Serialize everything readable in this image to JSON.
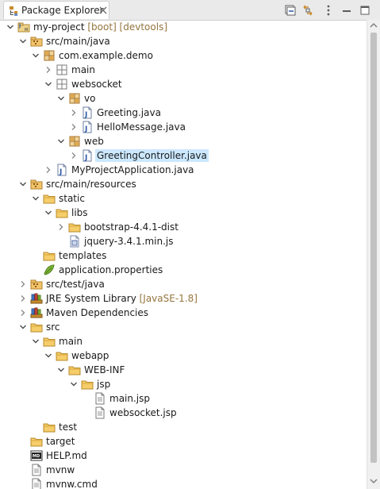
{
  "view": {
    "tab_title": "Package Explorer",
    "tab_icon": "package-explorer-icon",
    "toolbar": [
      {
        "name": "collapse-all-button",
        "icon": "collapse-all-icon"
      },
      {
        "name": "link-with-editor-button",
        "icon": "link-with-editor-icon"
      },
      {
        "name": "view-menu-button",
        "icon": "view-menu-icon"
      },
      {
        "name": "minimize-button",
        "icon": "minimize-icon"
      },
      {
        "name": "maximize-button",
        "icon": "maximize-icon"
      }
    ]
  },
  "tree": [
    {
      "depth": 0,
      "expand": "open",
      "icon": "project",
      "label": "my-project",
      "decor": "[boot] [devtools]"
    },
    {
      "depth": 1,
      "expand": "open",
      "icon": "source-folder",
      "label": "src/main/java"
    },
    {
      "depth": 2,
      "expand": "open",
      "icon": "package",
      "label": "com.example.demo"
    },
    {
      "depth": 3,
      "expand": "closed",
      "icon": "package-empty",
      "label": "main"
    },
    {
      "depth": 3,
      "expand": "open",
      "icon": "package-empty",
      "label": "websocket"
    },
    {
      "depth": 4,
      "expand": "open",
      "icon": "package",
      "label": "vo"
    },
    {
      "depth": 5,
      "expand": "closed",
      "icon": "java-file",
      "label": "Greeting.java"
    },
    {
      "depth": 5,
      "expand": "closed",
      "icon": "java-file",
      "label": "HelloMessage.java"
    },
    {
      "depth": 4,
      "expand": "open",
      "icon": "package",
      "label": "web"
    },
    {
      "depth": 5,
      "expand": "closed",
      "icon": "java-file",
      "label": "GreetingController.java",
      "selected": true
    },
    {
      "depth": 3,
      "expand": "closed",
      "icon": "java-file",
      "label": "MyProjectApplication.java"
    },
    {
      "depth": 1,
      "expand": "open",
      "icon": "source-folder",
      "label": "src/main/resources"
    },
    {
      "depth": 2,
      "expand": "open",
      "icon": "folder",
      "label": "static"
    },
    {
      "depth": 3,
      "expand": "open",
      "icon": "folder",
      "label": "libs"
    },
    {
      "depth": 4,
      "expand": "closed",
      "icon": "folder",
      "label": "bootstrap-4.4.1-dist"
    },
    {
      "depth": 4,
      "expand": "none",
      "icon": "js-file",
      "label": "jquery-3.4.1.min.js"
    },
    {
      "depth": 2,
      "expand": "none",
      "icon": "folder",
      "label": "templates"
    },
    {
      "depth": 2,
      "expand": "none",
      "icon": "properties-file",
      "label": "application.properties"
    },
    {
      "depth": 1,
      "expand": "closed",
      "icon": "source-folder",
      "label": "src/test/java"
    },
    {
      "depth": 1,
      "expand": "closed",
      "icon": "library",
      "label": "JRE System Library",
      "decor": "[JavaSE-1.8]"
    },
    {
      "depth": 1,
      "expand": "closed",
      "icon": "library",
      "label": "Maven Dependencies"
    },
    {
      "depth": 1,
      "expand": "open",
      "icon": "folder",
      "label": "src"
    },
    {
      "depth": 2,
      "expand": "open",
      "icon": "folder",
      "label": "main"
    },
    {
      "depth": 3,
      "expand": "open",
      "icon": "folder",
      "label": "webapp"
    },
    {
      "depth": 4,
      "expand": "open",
      "icon": "folder",
      "label": "WEB-INF"
    },
    {
      "depth": 5,
      "expand": "open",
      "icon": "folder",
      "label": "jsp"
    },
    {
      "depth": 6,
      "expand": "none",
      "icon": "text-file",
      "label": "main.jsp"
    },
    {
      "depth": 6,
      "expand": "none",
      "icon": "text-file",
      "label": "websocket.jsp"
    },
    {
      "depth": 2,
      "expand": "none",
      "icon": "folder",
      "label": "test"
    },
    {
      "depth": 1,
      "expand": "none",
      "icon": "folder",
      "label": "target"
    },
    {
      "depth": 1,
      "expand": "none",
      "icon": "md-file",
      "label": "HELP.md"
    },
    {
      "depth": 1,
      "expand": "none",
      "icon": "text-file",
      "label": "mvnw"
    },
    {
      "depth": 1,
      "expand": "none",
      "icon": "text-file",
      "label": "mvnw.cmd"
    }
  ]
}
